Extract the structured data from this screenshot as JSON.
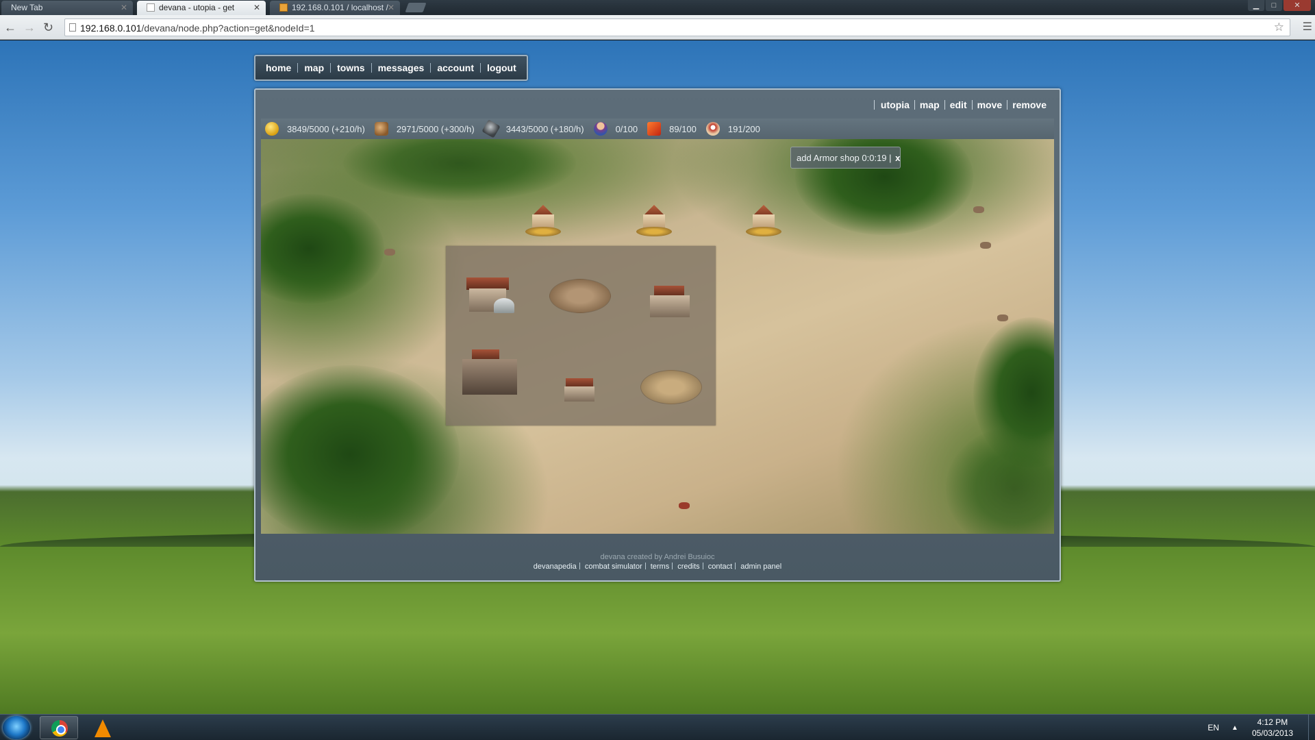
{
  "browser": {
    "tabs": [
      {
        "title": "New Tab",
        "active": false
      },
      {
        "title": "devana - utopia - get",
        "active": true
      },
      {
        "title": "192.168.0.101 / localhost /",
        "active": false
      }
    ],
    "url_host": "192.168.0.101",
    "url_path": "/devana/node.php?action=get&nodeId=1",
    "window_controls": {
      "minimize": "▁",
      "maximize": "□",
      "close": "✕"
    }
  },
  "top_nav": {
    "items": [
      "home",
      "map",
      "towns",
      "messages",
      "account",
      "logout"
    ]
  },
  "node_menu": {
    "items": [
      "utopia",
      "map",
      "edit",
      "move",
      "remove"
    ]
  },
  "resources": [
    {
      "icon": "gold-icon",
      "text": "3849/5000 (+210/h)"
    },
    {
      "icon": "lumber-icon",
      "text": "2971/5000 (+300/h)"
    },
    {
      "icon": "stone-icon",
      "text": "3443/5000 (+180/h)"
    },
    {
      "icon": "population-icon",
      "text": "0/100"
    },
    {
      "icon": "food-icon",
      "text": "89/100"
    },
    {
      "icon": "army-icon",
      "text": "191/200"
    }
  ],
  "queue": {
    "text": "add Armor shop 0:0:19 |",
    "close": "x"
  },
  "footer": {
    "credit": "devana created by Andrei Busuioc",
    "links": [
      "devanapedia",
      "combat simulator",
      "terms",
      "credits",
      "contact",
      "admin panel"
    ]
  },
  "taskbar": {
    "apps": [
      "chrome-icon",
      "vlc-icon"
    ],
    "language": "EN",
    "time": "4:12 PM",
    "date": "05/03/2013"
  }
}
